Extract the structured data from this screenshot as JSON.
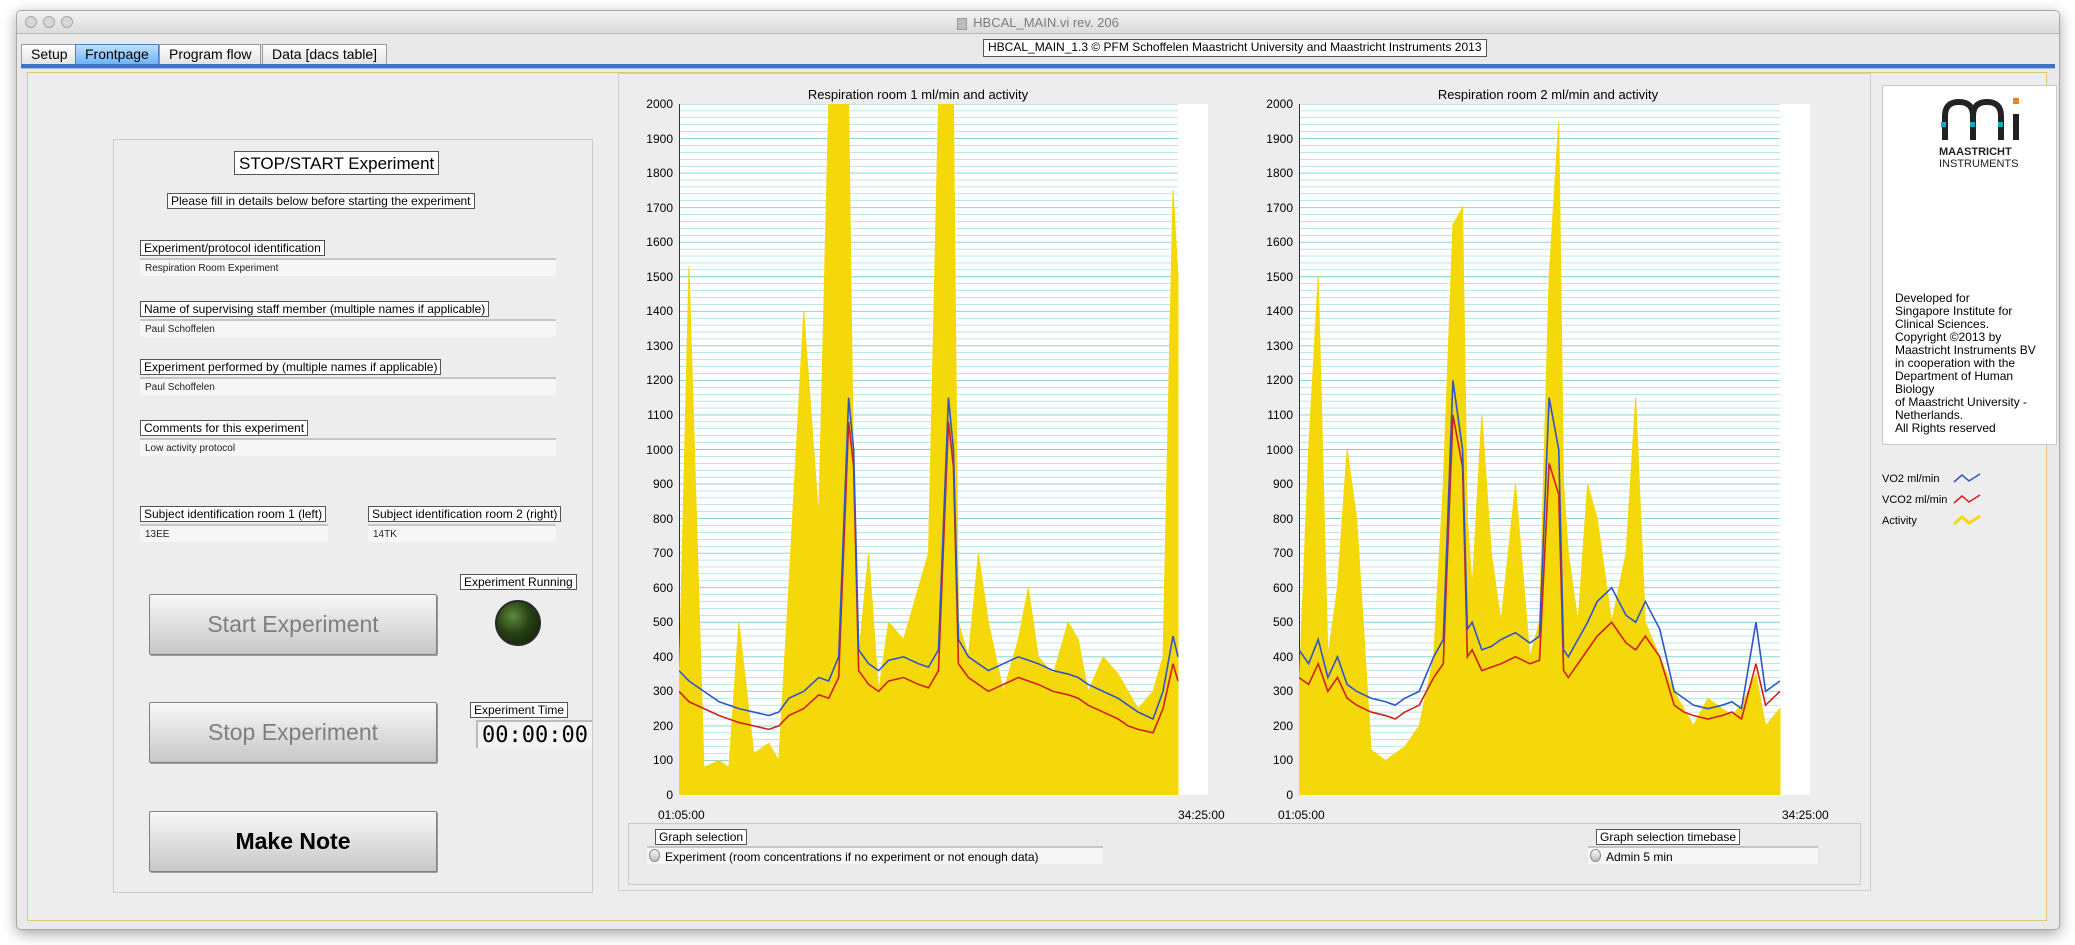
{
  "window": {
    "title": "HBCAL_MAIN.vi rev. 206"
  },
  "tabs": [
    {
      "label": "Setup",
      "active": false
    },
    {
      "label": "Frontpage",
      "active": true
    },
    {
      "label": "Program flow",
      "active": false
    },
    {
      "label": "Data [dacs table]",
      "active": false
    }
  ],
  "copyright": "HBCAL_MAIN_1.3  © PFM Schoffelen Maastricht University and Maastricht Instruments 2013",
  "experiment": {
    "title": "STOP/START Experiment",
    "instruction": "Please fill in details below before starting the experiment",
    "protocol_label": "Experiment/protocol identification",
    "protocol_value": "Respiration Room Experiment",
    "supervisor_label": "Name of supervising staff member   (multiple names if applicable)",
    "supervisor_value": "Paul Schoffelen",
    "performer_label": "Experiment performed by     (multiple names if applicable)",
    "performer_value": "Paul Schoffelen",
    "comments_label": "Comments for this experiment",
    "comments_value": "Low activity protocol",
    "subject1_label": "Subject identification room 1 (left)",
    "subject1_value": "13EE",
    "subject2_label": "Subject identification room 2 (right)",
    "subject2_value": "14TK",
    "running_label": "Experiment Running",
    "time_label": "Experiment Time",
    "time_value": "00:00:00",
    "start_label": "Start Experiment",
    "stop_label": "Stop Experiment",
    "note_label": "Make Note"
  },
  "graphs": {
    "selection_label": "Graph selection",
    "selection_value": "Experiment  (room concentrations if no experiment or  not enough data)",
    "timebase_label": "Graph selection timebase",
    "timebase_value": "Admin 5 min"
  },
  "info": {
    "brand_line1": "MAASTRICHT",
    "brand_line2": "INSTRUMENTS",
    "text": [
      "Developed for",
      "Singapore Institute for",
      "Clinical Sciences.",
      "Copyright ©2013 by",
      "Maastricht Instruments BV",
      "in cooperation with the",
      "Department of Human",
      "Biology",
      "of Maastricht University -",
      "Netherlands.",
      "All Rights reserved"
    ]
  },
  "legend": [
    {
      "label": "VO2   ml/min",
      "color": "#2f55c8"
    },
    {
      "label": "VCO2  ml/min",
      "color": "#d02020"
    },
    {
      "label": "Activity",
      "color": "#f5d80a"
    }
  ],
  "colors": {
    "vo2": "#2f55c8",
    "vco2": "#d02020",
    "activity": "#f5d80a",
    "grid": "#7ccfcf"
  },
  "chart_data": [
    {
      "type": "line",
      "title": "Respiration room 1 ml/min and activity",
      "ylim": [
        0,
        2000
      ],
      "yticks": [
        0,
        100,
        200,
        300,
        400,
        500,
        600,
        700,
        800,
        900,
        1000,
        1100,
        1200,
        1300,
        1400,
        1500,
        1600,
        1700,
        1800,
        1900,
        2000
      ],
      "xlim": [
        "01:05:00",
        "34:25:00"
      ],
      "x_fraction": [
        0,
        0.02,
        0.05,
        0.08,
        0.1,
        0.12,
        0.15,
        0.18,
        0.2,
        0.22,
        0.25,
        0.28,
        0.3,
        0.32,
        0.34,
        0.35,
        0.36,
        0.38,
        0.4,
        0.42,
        0.45,
        0.48,
        0.5,
        0.52,
        0.54,
        0.55,
        0.56,
        0.58,
        0.6,
        0.62,
        0.65,
        0.68,
        0.7,
        0.72,
        0.75,
        0.78,
        0.8,
        0.82,
        0.85,
        0.88,
        0.9,
        0.92,
        0.95,
        0.97,
        0.99,
        1.0
      ],
      "series": [
        {
          "name": "VO2   ml/min",
          "values": [
            360,
            330,
            300,
            270,
            260,
            250,
            240,
            230,
            240,
            280,
            300,
            340,
            330,
            400,
            1150,
            1000,
            420,
            380,
            360,
            390,
            400,
            380,
            370,
            420,
            1150,
            1000,
            450,
            400,
            380,
            360,
            380,
            400,
            390,
            380,
            360,
            350,
            340,
            320,
            300,
            280,
            260,
            240,
            220,
            300,
            460,
            400
          ]
        },
        {
          "name": "VCO2  ml/min",
          "values": [
            300,
            270,
            250,
            230,
            220,
            210,
            200,
            190,
            200,
            230,
            250,
            290,
            280,
            340,
            1080,
            950,
            360,
            320,
            300,
            330,
            340,
            320,
            310,
            360,
            1080,
            950,
            380,
            340,
            320,
            300,
            320,
            340,
            330,
            320,
            300,
            290,
            280,
            260,
            240,
            220,
            200,
            190,
            180,
            250,
            380,
            330
          ]
        },
        {
          "name": "Activity",
          "values": [
            300,
            1530,
            80,
            100,
            80,
            500,
            120,
            150,
            100,
            600,
            1400,
            800,
            2000,
            2000,
            2000,
            900,
            400,
            700,
            300,
            500,
            450,
            600,
            700,
            2000,
            2000,
            2000,
            500,
            400,
            700,
            500,
            300,
            450,
            600,
            400,
            350,
            500,
            450,
            300,
            400,
            350,
            300,
            250,
            300,
            400,
            1750,
            1500
          ]
        }
      ]
    },
    {
      "type": "line",
      "title": "Respiration room 2 ml/min and activity",
      "ylim": [
        0,
        2000
      ],
      "yticks": [
        0,
        100,
        200,
        300,
        400,
        500,
        600,
        700,
        800,
        900,
        1000,
        1100,
        1200,
        1300,
        1400,
        1500,
        1600,
        1700,
        1800,
        1900,
        2000
      ],
      "xlim": [
        "01:05:00",
        "34:25:00"
      ],
      "x_fraction": [
        0,
        0.02,
        0.04,
        0.06,
        0.08,
        0.1,
        0.12,
        0.15,
        0.18,
        0.2,
        0.22,
        0.25,
        0.28,
        0.3,
        0.32,
        0.34,
        0.35,
        0.36,
        0.38,
        0.4,
        0.42,
        0.45,
        0.48,
        0.5,
        0.52,
        0.54,
        0.55,
        0.56,
        0.58,
        0.6,
        0.62,
        0.65,
        0.68,
        0.7,
        0.72,
        0.75,
        0.78,
        0.8,
        0.82,
        0.85,
        0.88,
        0.9,
        0.92,
        0.95,
        0.97,
        1.0
      ],
      "series": [
        {
          "name": "VO2   ml/min",
          "values": [
            420,
            380,
            450,
            340,
            400,
            320,
            300,
            280,
            270,
            260,
            280,
            300,
            400,
            450,
            1200,
            1000,
            480,
            500,
            420,
            430,
            450,
            470,
            440,
            460,
            1150,
            1000,
            420,
            400,
            450,
            500,
            560,
            600,
            520,
            500,
            560,
            480,
            300,
            280,
            260,
            250,
            260,
            270,
            250,
            500,
            300,
            330
          ]
        },
        {
          "name": "VCO2  ml/min",
          "values": [
            340,
            320,
            380,
            300,
            340,
            280,
            260,
            240,
            230,
            220,
            240,
            260,
            340,
            380,
            1100,
            950,
            400,
            420,
            360,
            370,
            380,
            400,
            380,
            390,
            960,
            870,
            360,
            340,
            380,
            420,
            460,
            500,
            440,
            420,
            460,
            400,
            260,
            240,
            230,
            220,
            230,
            240,
            220,
            380,
            260,
            300
          ]
        },
        {
          "name": "Activity",
          "values": [
            300,
            1000,
            1500,
            400,
            600,
            1000,
            800,
            130,
            100,
            120,
            140,
            200,
            400,
            900,
            1650,
            1700,
            800,
            600,
            1100,
            700,
            500,
            900,
            400,
            500,
            1500,
            1950,
            900,
            700,
            500,
            900,
            800,
            500,
            700,
            1150,
            500,
            400,
            300,
            250,
            200,
            280,
            250,
            230,
            260,
            350,
            200,
            250
          ]
        }
      ]
    }
  ]
}
